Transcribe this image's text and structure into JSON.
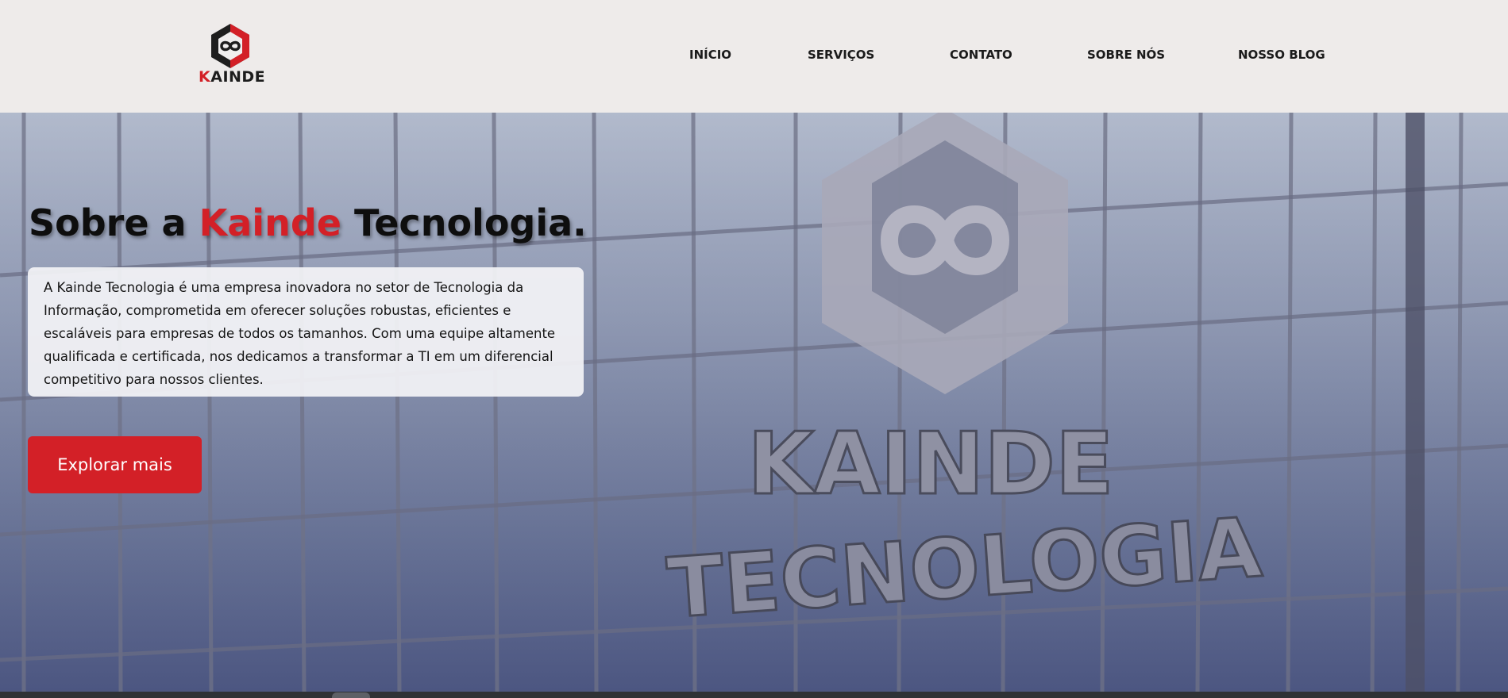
{
  "colors": {
    "accent": "#d32027",
    "header_bg": "#eeebea",
    "text_dark": "#151515"
  },
  "logo": {
    "icon": "infinity-hexagon-logo-icon",
    "initial": "K",
    "rest": "AINDE"
  },
  "nav": {
    "items": [
      {
        "label": "INÍCIO"
      },
      {
        "label": "SERVIÇOS"
      },
      {
        "label": "CONTATO"
      },
      {
        "label": "SOBRE NÓS"
      },
      {
        "label": "NOSSO BLOG"
      }
    ]
  },
  "hero": {
    "title_prefix": "Sobre a ",
    "title_accent": "Kainde",
    "title_suffix": " Tecnologia.",
    "description": "A Kainde Tecnologia é uma empresa inovadora no setor de Tecnologia da Informação, comprometida em oferecer soluções robustas, eficientes e escaláveis para empresas de todos os tamanhos. Com uma equipe altamente qualificada e certificada, nos dedicamos a transformar a TI em um diferencial competitivo para nossos clientes.",
    "button_label": "Explorar mais",
    "sign_line1": "KAINDE",
    "sign_line2": "TECNOLOGIA"
  }
}
